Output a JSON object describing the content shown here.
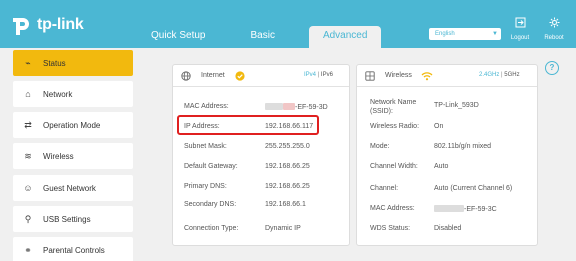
{
  "brand": {
    "logo_text": "tp-link",
    "color": "#4bb7d3",
    "accent": "#f2b90e",
    "highlight": "#e02020"
  },
  "nav": {
    "tabs": [
      {
        "label": "Quick Setup"
      },
      {
        "label": "Basic"
      },
      {
        "label": "Advanced",
        "active": true
      }
    ]
  },
  "toolbar": {
    "language": "English",
    "logout_label": "Logout",
    "reboot_label": "Reboot"
  },
  "sidebar": {
    "items": [
      {
        "label": "Status",
        "icon": "pulse-icon",
        "active": true
      },
      {
        "label": "Network",
        "icon": "network-icon"
      },
      {
        "label": "Operation Mode",
        "icon": "operation-mode-icon"
      },
      {
        "label": "Wireless",
        "icon": "wifi-icon"
      },
      {
        "label": "Guest Network",
        "icon": "guest-icon"
      },
      {
        "label": "USB Settings",
        "icon": "usb-icon"
      },
      {
        "label": "Parental Controls",
        "icon": "parental-icon"
      }
    ]
  },
  "internet": {
    "title": "Internet",
    "ipv4": "IPv4",
    "sep": "|",
    "ipv6": "IPv6",
    "rows": [
      {
        "label": "MAC Address:",
        "value": "-EF-59-3D"
      },
      {
        "label": "IP Address:",
        "value": "192.168.66.117"
      },
      {
        "label": "Subnet Mask:",
        "value": "255.255.255.0"
      },
      {
        "label": "Default Gateway:",
        "value": "192.168.66.25"
      },
      {
        "label": "Primary DNS:",
        "value": "192.168.66.25"
      },
      {
        "label": "Secondary DNS:",
        "value": "192.168.66.1"
      },
      {
        "label": "Connection Type:",
        "value": "Dynamic IP"
      }
    ]
  },
  "wireless": {
    "title": "Wireless",
    "band1": "2.4GHz",
    "sep": "|",
    "band2": "5GHz",
    "rows": [
      {
        "label": "Network Name",
        "label2": "(SSID):",
        "value": "TP-Link_593D"
      },
      {
        "label": "Wireless Radio:",
        "value": "On"
      },
      {
        "label": "Mode:",
        "value": "802.11b/g/n mixed"
      },
      {
        "label": "Channel Width:",
        "value": "Auto"
      },
      {
        "label": "Channel:",
        "value": "Auto (Current Channel 6)"
      },
      {
        "label": "MAC Address:",
        "value": "-EF-59-3C"
      },
      {
        "label": "WDS Status:",
        "value": "Disabled"
      }
    ]
  },
  "help": {
    "glyph": "?"
  }
}
